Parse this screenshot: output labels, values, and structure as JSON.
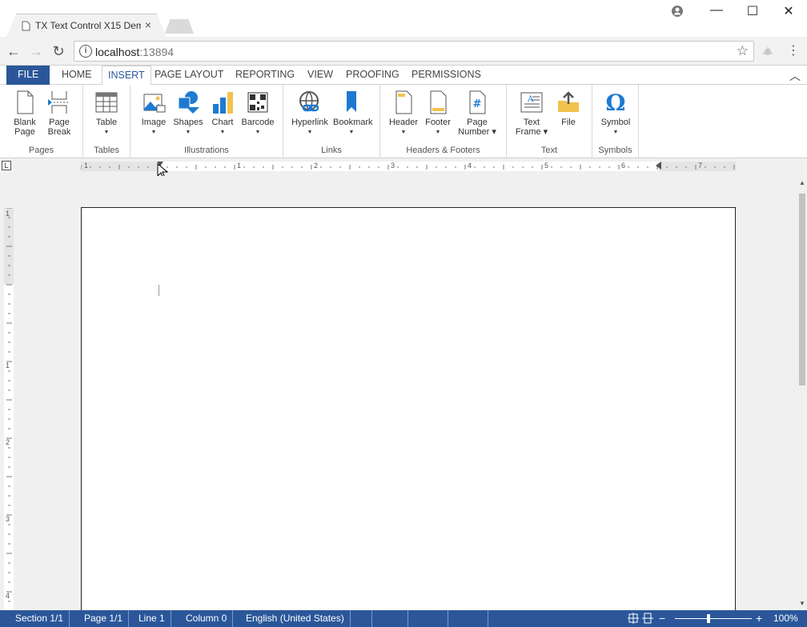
{
  "browser": {
    "tab_title": "TX Text Control X15 Dem",
    "tab_close": "×",
    "url_host": "localhost",
    "url_port": ":13894",
    "window_minimize": "—",
    "window_maximize": "☐",
    "window_close": "✕"
  },
  "ribbon_tabs": [
    {
      "label": "FILE"
    },
    {
      "label": "HOME"
    },
    {
      "label": "INSERT"
    },
    {
      "label": "PAGE LAYOUT"
    },
    {
      "label": "REPORTING"
    },
    {
      "label": "VIEW"
    },
    {
      "label": "PROOFING"
    },
    {
      "label": "PERMISSIONS"
    }
  ],
  "active_tab": "INSERT",
  "ribbon": {
    "pages": {
      "label": "Pages",
      "blank_page_1": "Blank",
      "blank_page_2": "Page",
      "page_break_1": "Page",
      "page_break_2": "Break"
    },
    "tables": {
      "label": "Tables",
      "table": "Table"
    },
    "illustrations": {
      "label": "Illustrations",
      "image": "Image",
      "shapes": "Shapes",
      "chart": "Chart",
      "barcode": "Barcode"
    },
    "links": {
      "label": "Links",
      "hyperlink": "Hyperlink",
      "bookmark": "Bookmark"
    },
    "headers_footers": {
      "label": "Headers & Footers",
      "header": "Header",
      "footer": "Footer",
      "page_number_1": "Page",
      "page_number_2": "Number ▾"
    },
    "text": {
      "label": "Text",
      "text_frame_1": "Text",
      "text_frame_2": "Frame ▾",
      "file": "File"
    },
    "symbols": {
      "label": "Symbols",
      "symbol": "Symbol"
    }
  },
  "ruler": {
    "h_numbers": [
      "1",
      "1",
      "2",
      "3",
      "4",
      "5",
      "6",
      "7"
    ],
    "v_numbers": [
      "1",
      "1",
      "2",
      "3",
      "4"
    ],
    "tab_stop": "L"
  },
  "status": {
    "section": "Section 1/1",
    "page": "Page 1/1",
    "line": "Line 1",
    "column": "Column 0",
    "language": "English (United States)",
    "zoom": "100%",
    "zoom_level": 0.44
  },
  "colors": {
    "brand": "#2b579a",
    "icon_blue": "#1e7ad1",
    "icon_yellow": "#f2c14e"
  }
}
